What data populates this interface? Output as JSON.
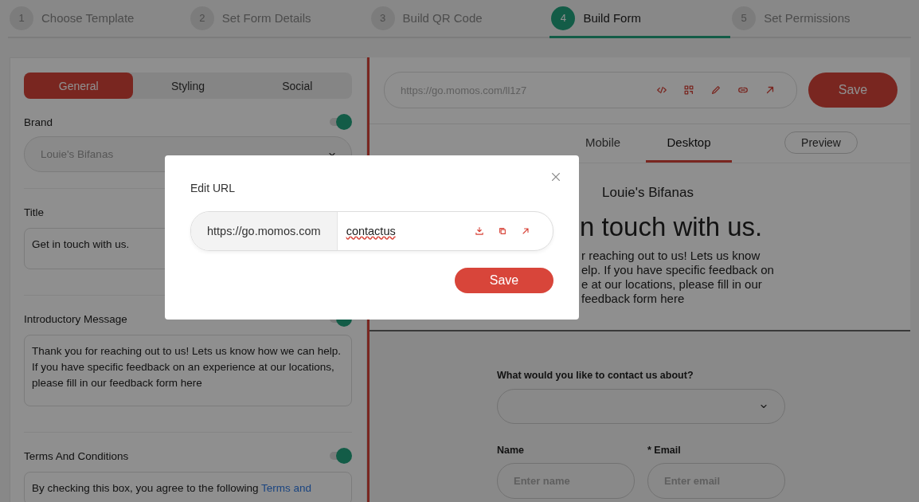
{
  "steps": [
    {
      "number": "1",
      "label": "Choose Template",
      "selected": false
    },
    {
      "number": "2",
      "label": "Set Form Details",
      "selected": false
    },
    {
      "number": "3",
      "label": "Build QR Code",
      "selected": false
    },
    {
      "number": "4",
      "label": "Build Form",
      "selected": true
    },
    {
      "number": "5",
      "label": "Set Permissions",
      "selected": false
    }
  ],
  "settings": {
    "tabs": [
      {
        "label": "General",
        "selected": true
      },
      {
        "label": "Styling",
        "selected": false
      },
      {
        "label": "Social",
        "selected": false
      }
    ],
    "brand": {
      "label": "Brand",
      "on": true,
      "value": "Louie's Bifanas"
    },
    "title": {
      "label": "Title",
      "value": "Get in touch with us."
    },
    "intro": {
      "label": "Introductory Message",
      "on": true,
      "value": "Thank you for reaching out to us! Lets us know how we can help. If you have specific feedback on an experience at our locations, please fill in our feedback form here"
    },
    "terms": {
      "label": "Terms And Conditions",
      "on": true,
      "text": "By checking this box, you agree to the following ",
      "link": "Terms and"
    }
  },
  "editor": {
    "url": "https://go.momos.com/ll1z7",
    "save": "Save",
    "view_tabs": [
      {
        "label": "Mobile",
        "selected": false
      },
      {
        "label": "Desktop",
        "selected": true
      }
    ],
    "preview_button": "Preview",
    "preview": {
      "brand": "Louie's Bifanas",
      "heading": "n touch with us.",
      "message_lines": [
        "r reaching out to us! Lets us know",
        "elp. If you have specific feedback on",
        "e at our locations, please fill in our",
        "feedback form here"
      ],
      "question": "What would you like to contact us about?",
      "name_label": "Name",
      "email_label": "* Email",
      "name_placeholder": "Enter name",
      "email_placeholder": "Enter email"
    }
  },
  "modal": {
    "title": "Edit URL",
    "prefix": "https://go.momos.com",
    "slug": "contactus",
    "save": "Save"
  }
}
